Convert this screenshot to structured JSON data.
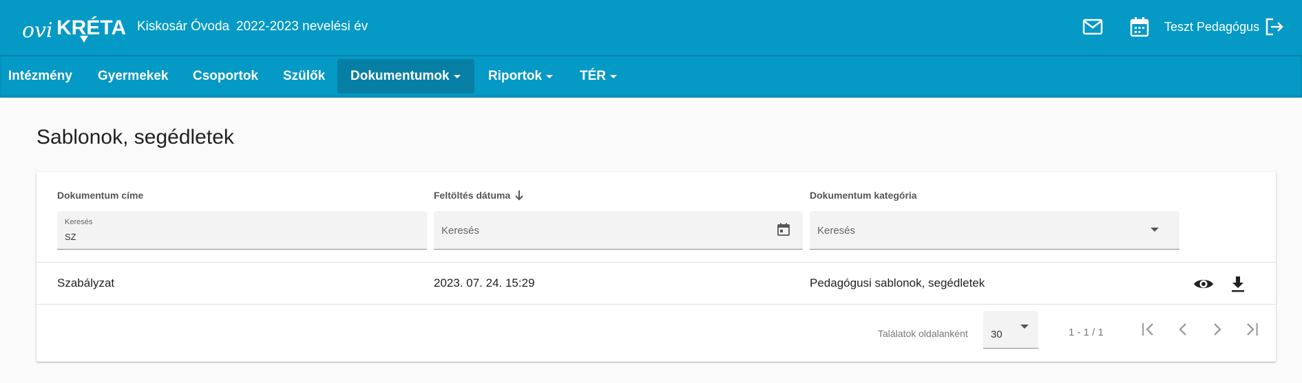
{
  "header": {
    "logo_text": "oviKRÉTA",
    "school_name": "Kiskosár Óvoda",
    "school_year": "2022-2023 nevelési év",
    "user_name": "Teszt Pedagógus"
  },
  "nav": {
    "items": [
      {
        "label": "Intézmény",
        "dropdown": false,
        "active": false
      },
      {
        "label": "Gyermekek",
        "dropdown": false,
        "active": false
      },
      {
        "label": "Csoportok",
        "dropdown": false,
        "active": false
      },
      {
        "label": "Szülők",
        "dropdown": false,
        "active": false
      },
      {
        "label": "Dokumentumok",
        "dropdown": true,
        "active": true
      },
      {
        "label": "Riportok",
        "dropdown": true,
        "active": false
      },
      {
        "label": "TÉR",
        "dropdown": true,
        "active": false
      }
    ]
  },
  "page": {
    "title": "Sablonok, segédletek"
  },
  "table": {
    "columns": [
      {
        "header": "Dokumentum címe",
        "filter_label": "Keresés",
        "filter_value": "SZ"
      },
      {
        "header": "Feltöltés dátuma",
        "filter_placeholder": "Keresés"
      },
      {
        "header": "Dokumentum kategória",
        "filter_placeholder": "Keresés"
      }
    ],
    "rows": [
      {
        "title": "Szabályzat",
        "date": "2023. 07. 24. 15:29",
        "category": "Pedagógusi sablonok, segédletek"
      }
    ]
  },
  "pagination": {
    "page_size_label": "Találatok oldalanként",
    "page_size": "30",
    "range": "1 - 1 / 1"
  },
  "colors": {
    "primary": "#0599c6",
    "nav_active": "#077fa4"
  }
}
